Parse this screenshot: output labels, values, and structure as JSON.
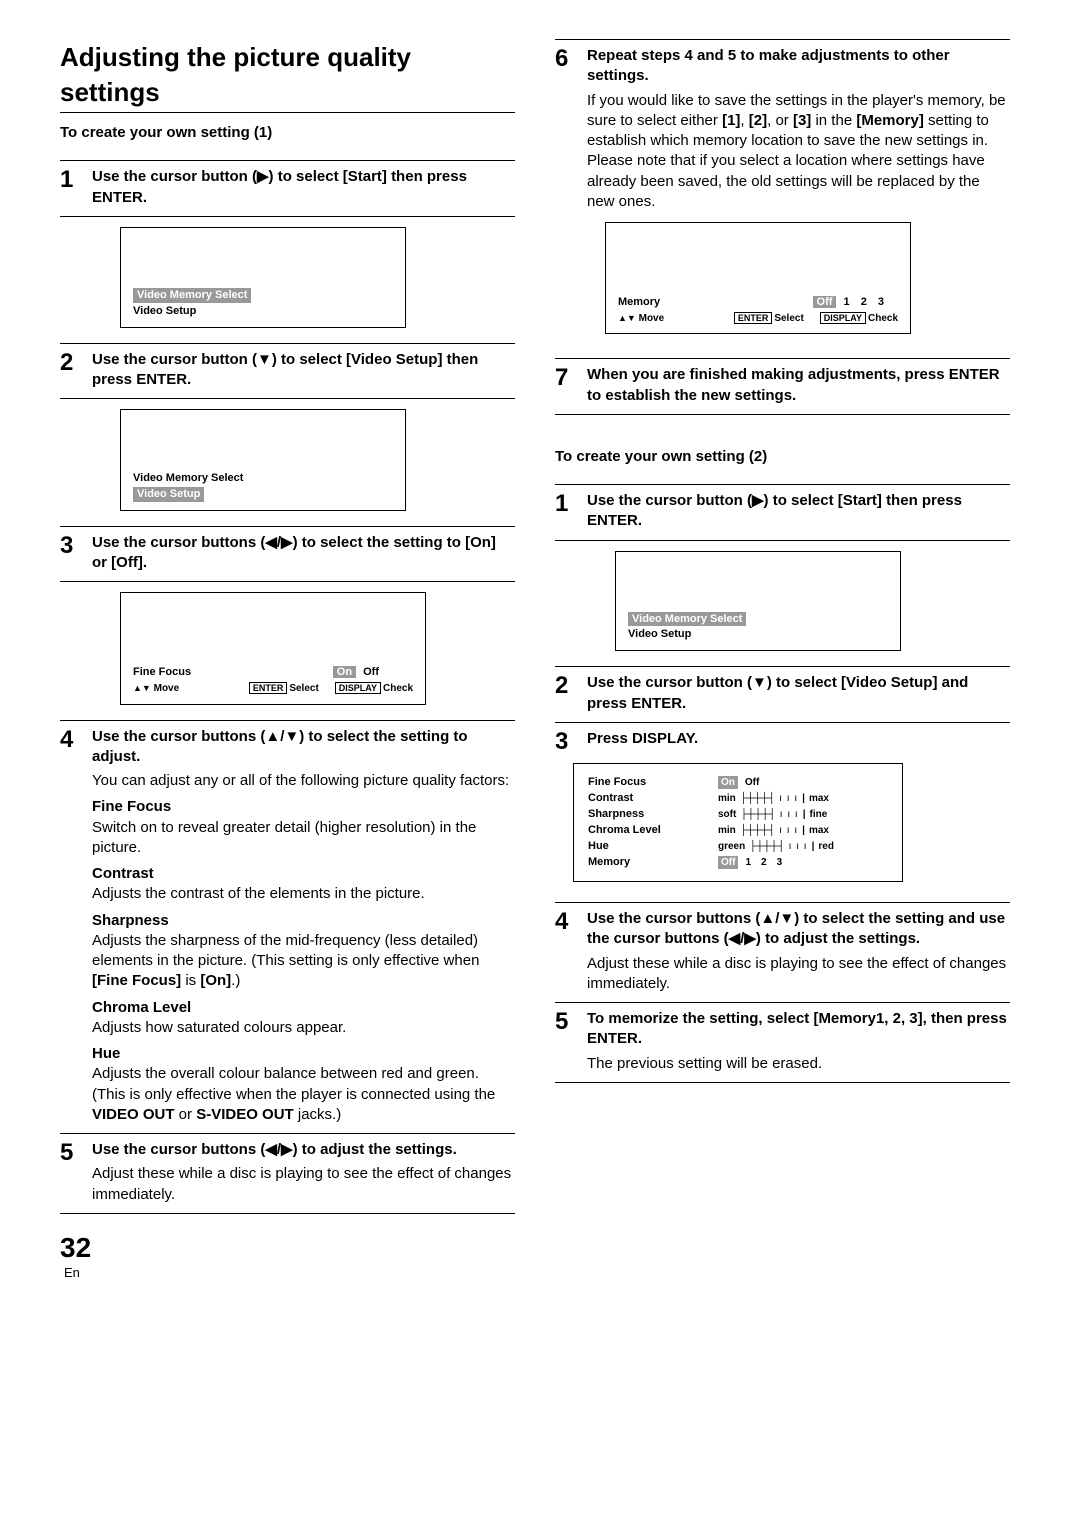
{
  "page": {
    "number": "32",
    "lang": "En"
  },
  "title": "Adjusting the picture quality settings",
  "section1": {
    "heading": "To create your own setting (1)",
    "steps": {
      "s1": {
        "num": "1",
        "lead": "Use the cursor button (▶) to select [Start] then press ENTER.",
        "fig": {
          "line1": "Video Memory Select",
          "line2": "Video Setup"
        }
      },
      "s2": {
        "num": "2",
        "lead": "Use the cursor button (▼) to select [Video Setup] then press ENTER.",
        "fig": {
          "line1": "Video Memory Select",
          "line2": "Video Setup"
        }
      },
      "s3": {
        "num": "3",
        "lead": "Use the cursor buttons (◀/▶) to select the setting to [On] or [Off].",
        "fig": {
          "param": "Fine Focus",
          "on": "On",
          "off": "Off",
          "move": "Move",
          "enter": "ENTER",
          "select": "Select",
          "display": "DISPLAY",
          "check": "Check"
        }
      },
      "s4": {
        "num": "4",
        "lead": "Use the cursor buttons (▲/▼) to select the setting to adjust.",
        "intro": "You can adjust any or all of the following picture quality factors:",
        "items": {
          "ff": {
            "name": "Fine Focus",
            "desc": "Switch on to reveal greater detail (higher resolution) in the picture."
          },
          "co": {
            "name": "Contrast",
            "desc": "Adjusts the contrast of the elements in the picture."
          },
          "sh": {
            "name": "Sharpness",
            "desc_a": "Adjusts the sharpness of the mid-frequency (less detailed) elements in the picture. (This setting is only effective when ",
            "desc_b": "[Fine Focus]",
            "desc_c": " is ",
            "desc_d": "[On]",
            "desc_e": ".)"
          },
          "cl": {
            "name": "Chroma Level",
            "desc": "Adjusts how saturated colours appear."
          },
          "hu": {
            "name": "Hue",
            "desc_a": "Adjusts the overall colour balance between red and green. (This is only effective when the player is connected using the ",
            "desc_b": "VIDEO OUT",
            "desc_c": " or ",
            "desc_d": "S-VIDEO OUT",
            "desc_e": " jacks.)"
          }
        }
      },
      "s5": {
        "num": "5",
        "lead": "Use the cursor buttons (◀/▶) to adjust the settings.",
        "note": "Adjust these while a disc is playing to see the effect of changes immediately."
      }
    }
  },
  "section2": {
    "steps": {
      "s6": {
        "num": "6",
        "lead": "Repeat steps 4 and 5 to make adjustments to other settings.",
        "text_a": "If you would like to save the settings in the player's memory, be sure to select either ",
        "m1": "[1]",
        "c1": ", ",
        "m2": "[2]",
        "c2": ", or ",
        "m3": "[3]",
        "text_b": " in the ",
        "mem": "[Memory]",
        "text_c": " setting to establish which memory location to save the new settings in. Please note that if you select a location where settings have already been saved, the old settings will be replaced by the new ones.",
        "fig": {
          "param": "Memory",
          "off": "Off",
          "n1": "1",
          "n2": "2",
          "n3": "3",
          "move": "Move",
          "enter": "ENTER",
          "select": "Select",
          "display": "DISPLAY",
          "check": "Check"
        }
      },
      "s7": {
        "num": "7",
        "lead": "When you are finished making adjustments, press ENTER to establish the new settings."
      }
    },
    "heading": "To create your own setting (2)",
    "steps2": {
      "s1": {
        "num": "1",
        "lead": "Use the cursor button (▶) to select [Start] then press ENTER.",
        "fig": {
          "line1": "Video Memory Select",
          "line2": "Video Setup"
        }
      },
      "s2": {
        "num": "2",
        "lead": "Use the cursor button (▼) to select [Video Setup] and press ENTER."
      },
      "s3": {
        "num": "3",
        "lead": "Press DISPLAY.",
        "fig": {
          "ff": "Fine Focus",
          "ff_on": "On",
          "ff_off": "Off",
          "co": "Contrast",
          "co_l": "min",
          "co_r": "max",
          "sh": "Sharpness",
          "sh_l": "soft",
          "sh_r": "fine",
          "cl": "Chroma Level",
          "cl_l": "min",
          "cl_r": "max",
          "hu": "Hue",
          "hu_l": "green",
          "hu_r": "red",
          "me": "Memory",
          "me_off": "Off",
          "me_1": "1",
          "me_2": "2",
          "me_3": "3"
        }
      },
      "s4": {
        "num": "4",
        "lead": "Use the cursor buttons (▲/▼) to select the setting and use the cursor buttons (◀/▶) to adjust the settings.",
        "note": "Adjust these while a disc is playing to see the effect of changes immediately."
      },
      "s5": {
        "num": "5",
        "lead": "To memorize the setting, select [Memory1, 2, 3], then press ENTER.",
        "note": "The previous setting will be erased."
      }
    }
  }
}
